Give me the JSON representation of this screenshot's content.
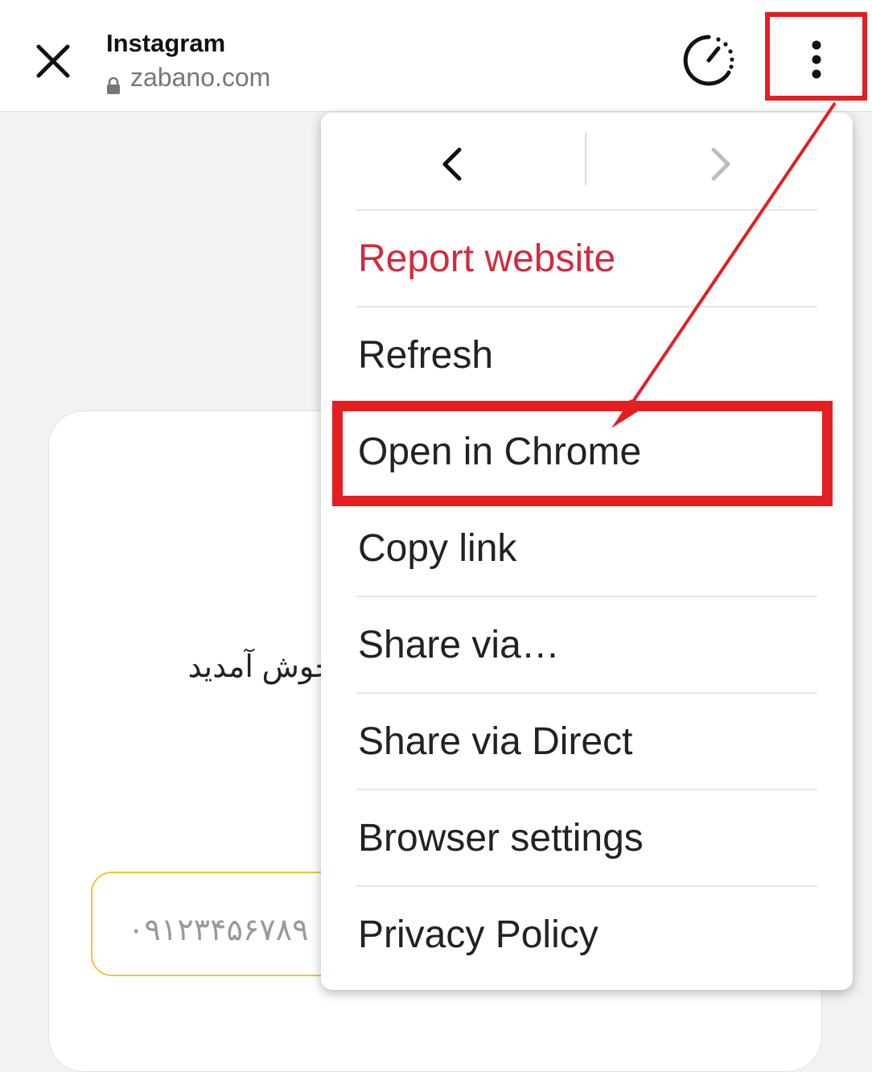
{
  "browser": {
    "title": "Instagram",
    "url": "zabano.com"
  },
  "page": {
    "welcome_text": "خوش آمدید",
    "phone_placeholder": "۰۹۱۲۳۴۵۶۷۸۹"
  },
  "menu": {
    "items": [
      {
        "label": "Report website"
      },
      {
        "label": "Refresh"
      },
      {
        "label": "Open in Chrome"
      },
      {
        "label": "Copy link"
      },
      {
        "label": "Share via…"
      },
      {
        "label": "Share via Direct"
      },
      {
        "label": "Browser settings"
      },
      {
        "label": "Privacy Policy"
      }
    ]
  },
  "colors": {
    "annotation_red": "#e41e21",
    "danger_text": "#d5293d",
    "field_border": "#f0c341"
  },
  "icons": [
    "close-icon",
    "lock-icon",
    "timer-icon",
    "more-vert-icon",
    "chevron-left-icon",
    "chevron-right-icon"
  ]
}
